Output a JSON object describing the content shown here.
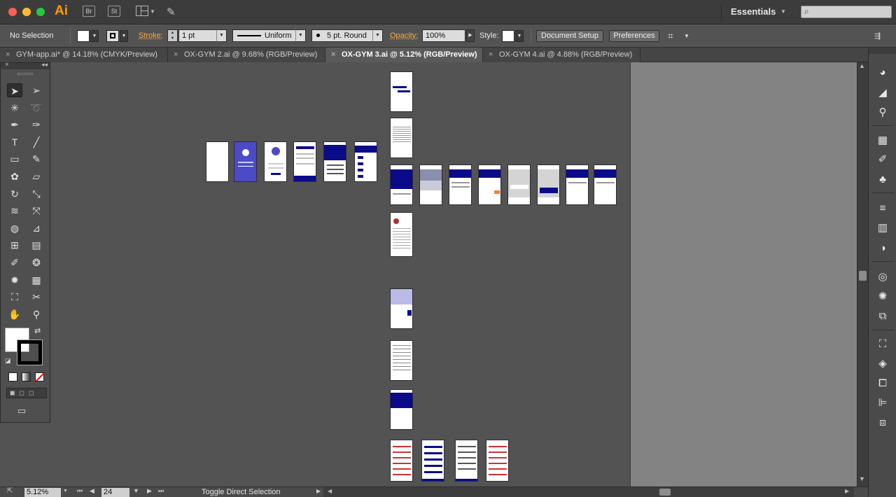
{
  "app": {
    "logo": "Ai",
    "bridge_label": "Br",
    "stock_label": "St",
    "workspace": "Essentials",
    "search_placeholder": ""
  },
  "control_bar": {
    "selection": "No Selection",
    "stroke_label": "Stroke:",
    "stroke_weight": "1 pt",
    "profile": "Uniform",
    "brush": "5 pt. Round",
    "opacity_label": "Opacity:",
    "opacity_value": "100%",
    "style_label": "Style:",
    "document_setup": "Document Setup",
    "preferences": "Preferences"
  },
  "tabs": [
    {
      "label": "GYM-app.ai* @ 14.18% (CMYK/Preview)",
      "active": false
    },
    {
      "label": "OX-GYM 2.ai @ 9.68% (RGB/Preview)",
      "active": false
    },
    {
      "label": "OX-GYM 3.ai @ 5.12% (RGB/Preview)",
      "active": true
    },
    {
      "label": "OX-GYM 4.ai @ 4.88% (RGB/Preview)",
      "active": false
    }
  ],
  "status": {
    "zoom": "5.12%",
    "artboard": "24",
    "tool_hint": "Toggle Direct Selection"
  },
  "colors": {
    "accent_orange": "#ffad3a",
    "artboard_blue": "#0b0b8a",
    "artboard_purple": "#4b4bc8",
    "pasteboard": "#535353"
  },
  "tools": [
    "selection-tool-icon",
    "direct-selection-tool-icon",
    "magic-wand-tool-icon",
    "lasso-tool-icon",
    "pen-tool-icon",
    "curvature-tool-icon",
    "type-tool-icon",
    "line-segment-tool-icon",
    "rectangle-tool-icon",
    "paintbrush-tool-icon",
    "shaper-tool-icon",
    "eraser-tool-icon",
    "rotate-tool-icon",
    "scale-tool-icon",
    "width-tool-icon",
    "free-transform-tool-icon",
    "shape-builder-tool-icon",
    "perspective-grid-tool-icon",
    "mesh-tool-icon",
    "gradient-tool-icon",
    "eyedropper-tool-icon",
    "blend-tool-icon",
    "symbol-sprayer-tool-icon",
    "column-graph-tool-icon",
    "artboard-tool-icon",
    "slice-tool-icon",
    "hand-tool-icon",
    "zoom-tool-icon"
  ]
}
